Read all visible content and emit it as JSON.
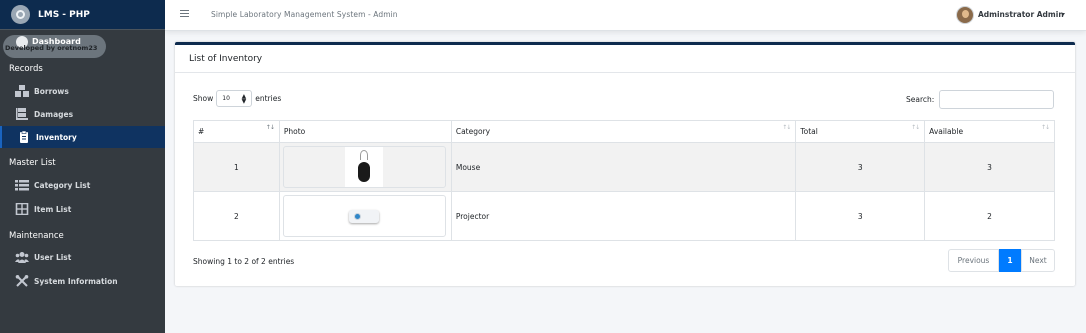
{
  "brand": {
    "name": "LMS - PHP"
  },
  "sidebar": {
    "dashboard_label": "Dashboard",
    "developer_note": "Developed by oretnom23",
    "sections": [
      {
        "header": "Records"
      },
      {
        "header": "Master List"
      },
      {
        "header": "Maintenance"
      }
    ],
    "items": [
      {
        "label": "Borrows",
        "icon": "boxes-icon"
      },
      {
        "label": "Damages",
        "icon": "dolly-icon"
      },
      {
        "label": "Inventory",
        "icon": "clipboard-icon"
      },
      {
        "label": "Category List",
        "icon": "list-icon"
      },
      {
        "label": "Item List",
        "icon": "grid-icon"
      },
      {
        "label": "User List",
        "icon": "users-icon"
      },
      {
        "label": "System Information",
        "icon": "tools-icon"
      }
    ],
    "active_item": "Inventory"
  },
  "topbar": {
    "title": "Simple Laboratory Management System - Admin",
    "user_name": "Adminstrator Admin"
  },
  "card": {
    "title": "List of Inventory"
  },
  "table_controls": {
    "show_label": "Show",
    "entries_value": "10",
    "entries_label": "entries",
    "search_label": "Search:",
    "search_value": ""
  },
  "table": {
    "columns": [
      "#",
      "Photo",
      "Category",
      "Total",
      "Available"
    ],
    "rows": [
      {
        "num": "1",
        "photo": "mouse",
        "category": "Mouse",
        "total": "3",
        "available": "3"
      },
      {
        "num": "2",
        "photo": "projector",
        "category": "Projector",
        "total": "3",
        "available": "2"
      }
    ]
  },
  "footer": {
    "info": "Showing 1 to 2 of 2 entries",
    "prev_label": "Previous",
    "current_page": "1",
    "next_label": "Next"
  },
  "colors": {
    "sidebar_bg": "#343a40",
    "brand_bg": "#0d2b4e",
    "active_bg": "#0f3361",
    "accent": "#007bff"
  }
}
